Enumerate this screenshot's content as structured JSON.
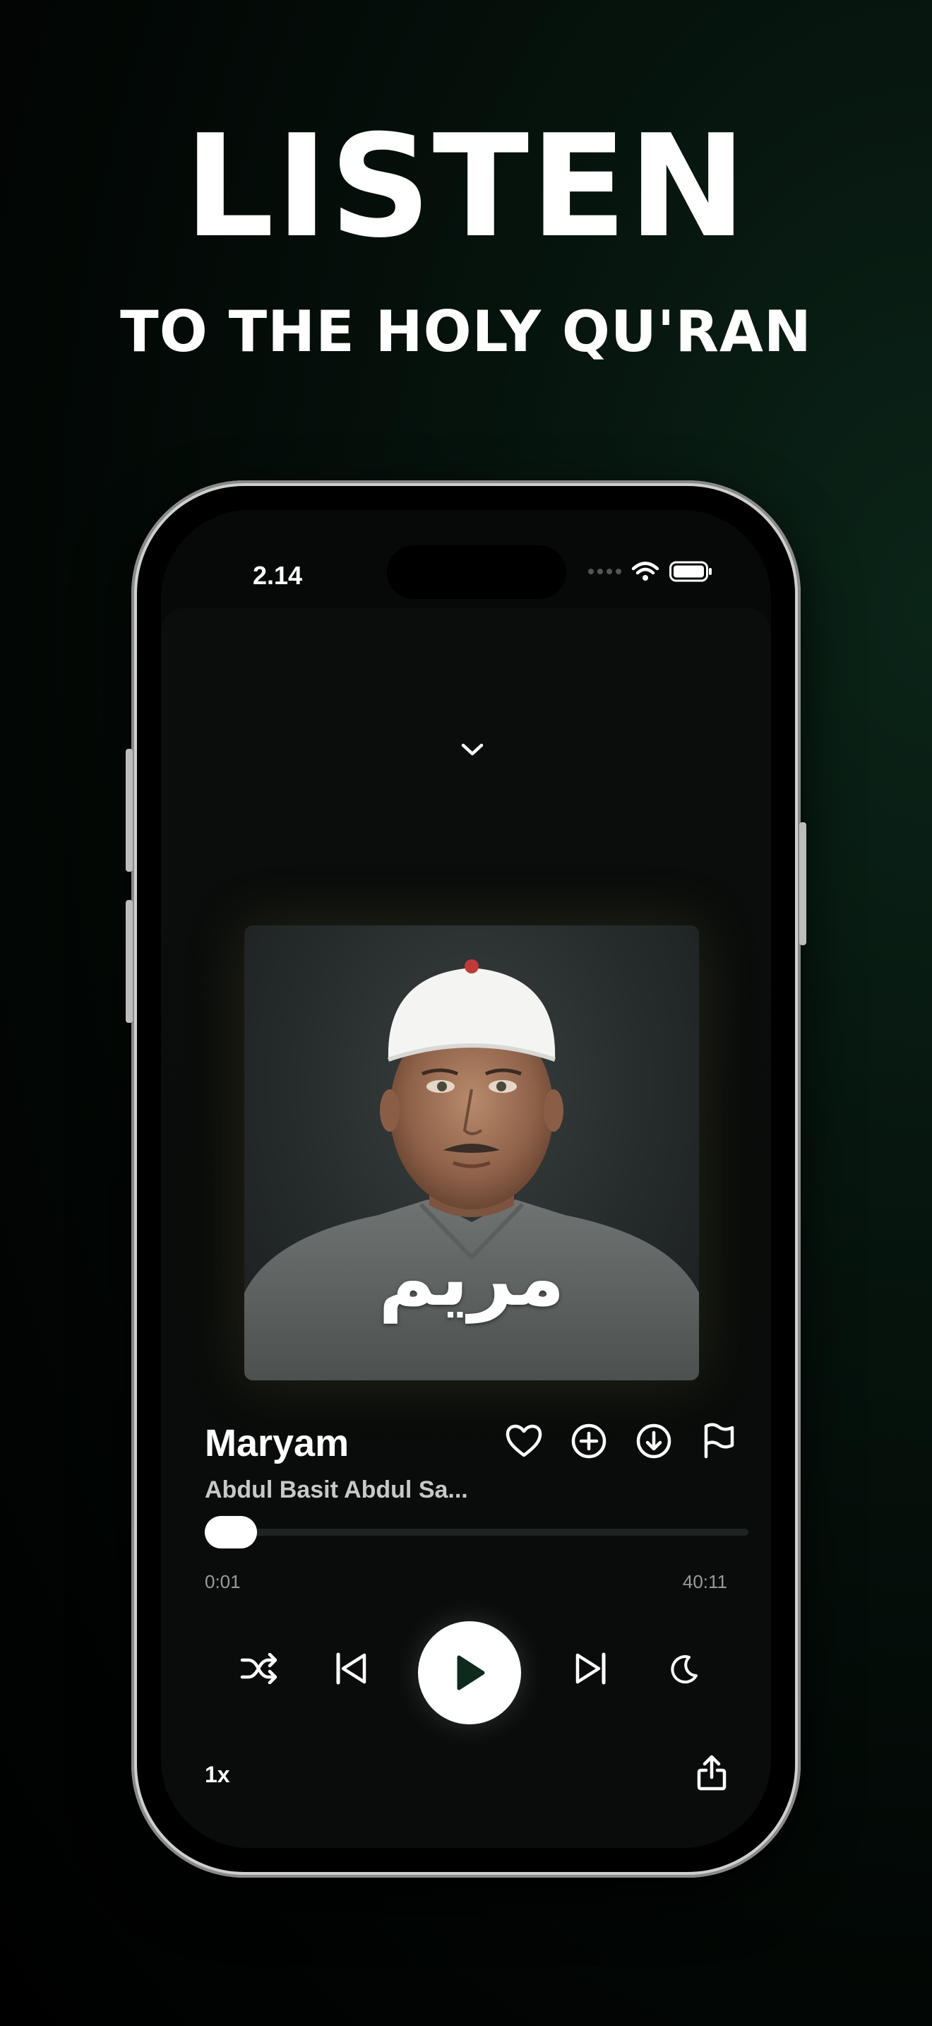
{
  "promo": {
    "headline": "LISTEN",
    "subline": "TO THE HOLY QU'RAN"
  },
  "status_bar": {
    "time": "2.14",
    "icons": [
      "signal-icon",
      "wifi-icon",
      "battery-icon"
    ]
  },
  "player": {
    "collapse_icon": "chevron-down-icon",
    "artwork_calligraphy": "مريم",
    "title": "Maryam",
    "artist": "Abdul Basit Abdul Sa...",
    "actions": [
      "heart-icon",
      "add-circle-icon",
      "download-circle-icon",
      "flag-icon"
    ],
    "progress": 0.0004,
    "elapsed": "0:01",
    "duration": "40:11",
    "controls": [
      "shuffle-icon",
      "previous-icon",
      "play-icon",
      "next-icon",
      "sleep-timer-icon"
    ],
    "speed": "1x",
    "share_icon": "share-icon"
  },
  "colors": {
    "background": "#050c08",
    "accent_play": "#0e2a1c",
    "text": "#ffffff",
    "muted": "#c8c8c8"
  }
}
